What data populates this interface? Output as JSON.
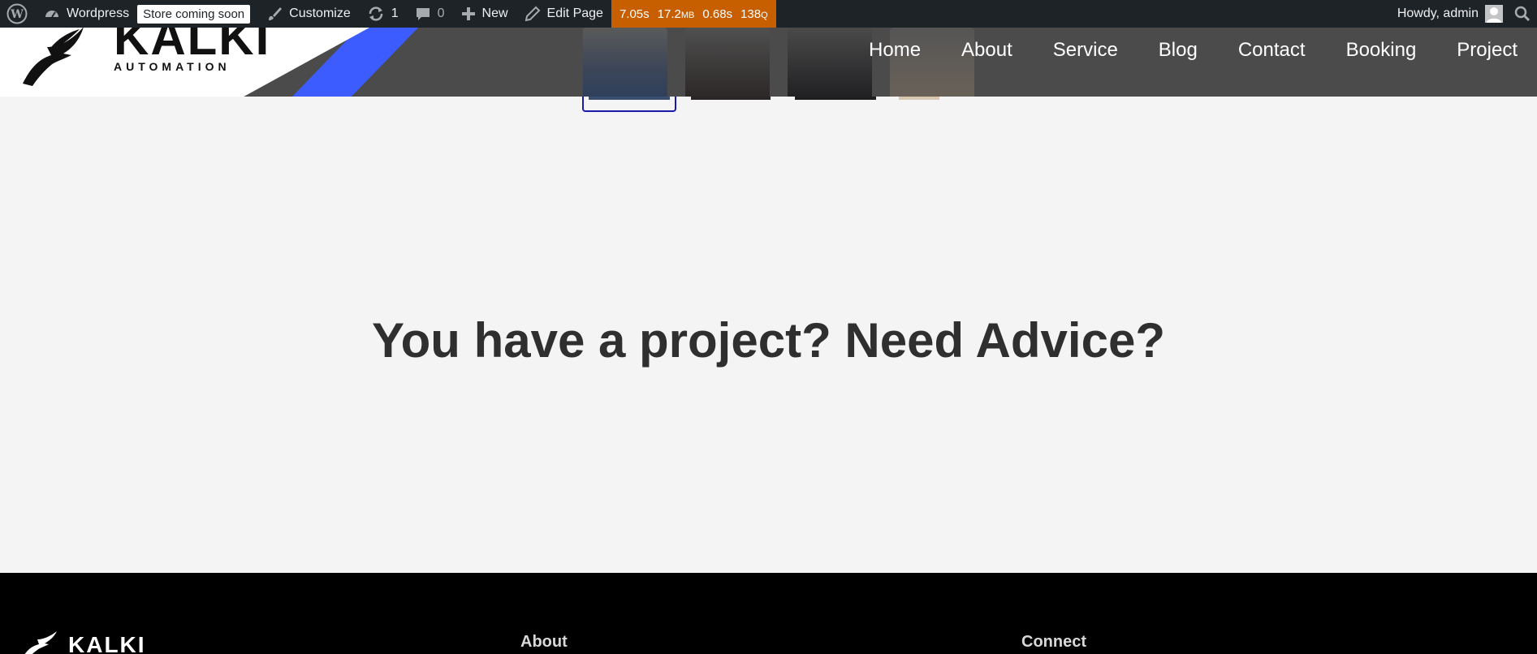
{
  "admin_bar": {
    "site_name": "Wordpress",
    "store_badge": "Store coming soon",
    "customize": "Customize",
    "updates_count": "1",
    "comments_count": "0",
    "new": "New",
    "edit_page": "Edit Page",
    "qm": {
      "time": "7.05s",
      "memory": "17.2",
      "memory_unit": "MB",
      "db_time": "0.68s",
      "queries": "138",
      "queries_unit": "Q"
    },
    "howdy": "Howdy, admin",
    "colors": {
      "background": "#1d2327",
      "qm": "#c75e00"
    }
  },
  "header": {
    "logo_text": "KALKI",
    "logo_subtext": "AUTOMATION",
    "nav": [
      "Home",
      "About",
      "Service",
      "Blog",
      "Contact",
      "Booking",
      "Project"
    ],
    "colors": {
      "background": "#4b4b4b",
      "accent": "#3d5cff"
    }
  },
  "hero": {
    "cta_text": "You have a project? Need Advice?"
  },
  "footer": {
    "logo_text": "KALKI",
    "headings": [
      "About",
      "Connect"
    ]
  }
}
